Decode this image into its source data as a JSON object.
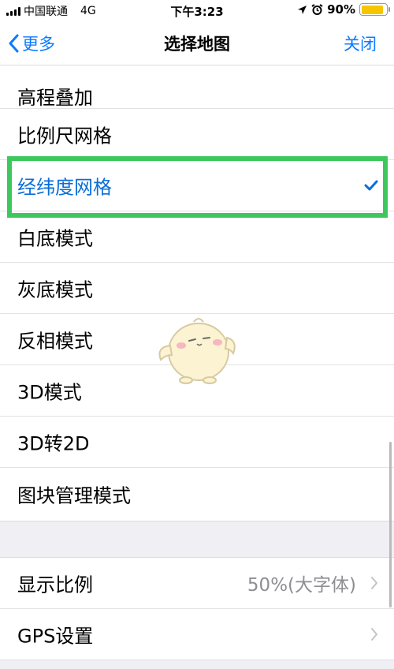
{
  "status_bar": {
    "carrier": "中国联通",
    "network": "4G",
    "time": "下午3:23",
    "battery_percent": "90%",
    "battery_level": 0.9
  },
  "nav": {
    "back_label": "更多",
    "title": "选择地图",
    "close_label": "关闭"
  },
  "map_options": [
    {
      "label": "高程叠加",
      "selected": false
    },
    {
      "label": "比例尺网格",
      "selected": false
    },
    {
      "label": "经纬度网格",
      "selected": true
    },
    {
      "label": "白底模式",
      "selected": false
    },
    {
      "label": "灰底模式",
      "selected": false
    },
    {
      "label": "反相模式",
      "selected": false
    },
    {
      "label": "3D模式",
      "selected": false
    },
    {
      "label": "3D转2D",
      "selected": false
    },
    {
      "label": "图块管理模式",
      "selected": false
    }
  ],
  "settings": {
    "display_scale": {
      "label": "显示比例",
      "value": "50%(大字体)"
    },
    "gps": {
      "label": "GPS设置"
    }
  },
  "colors": {
    "accent": "#0a7aff",
    "selected_text": "#0a6dd8",
    "highlight_border": "#3ec75d",
    "battery": "#f7c500"
  }
}
